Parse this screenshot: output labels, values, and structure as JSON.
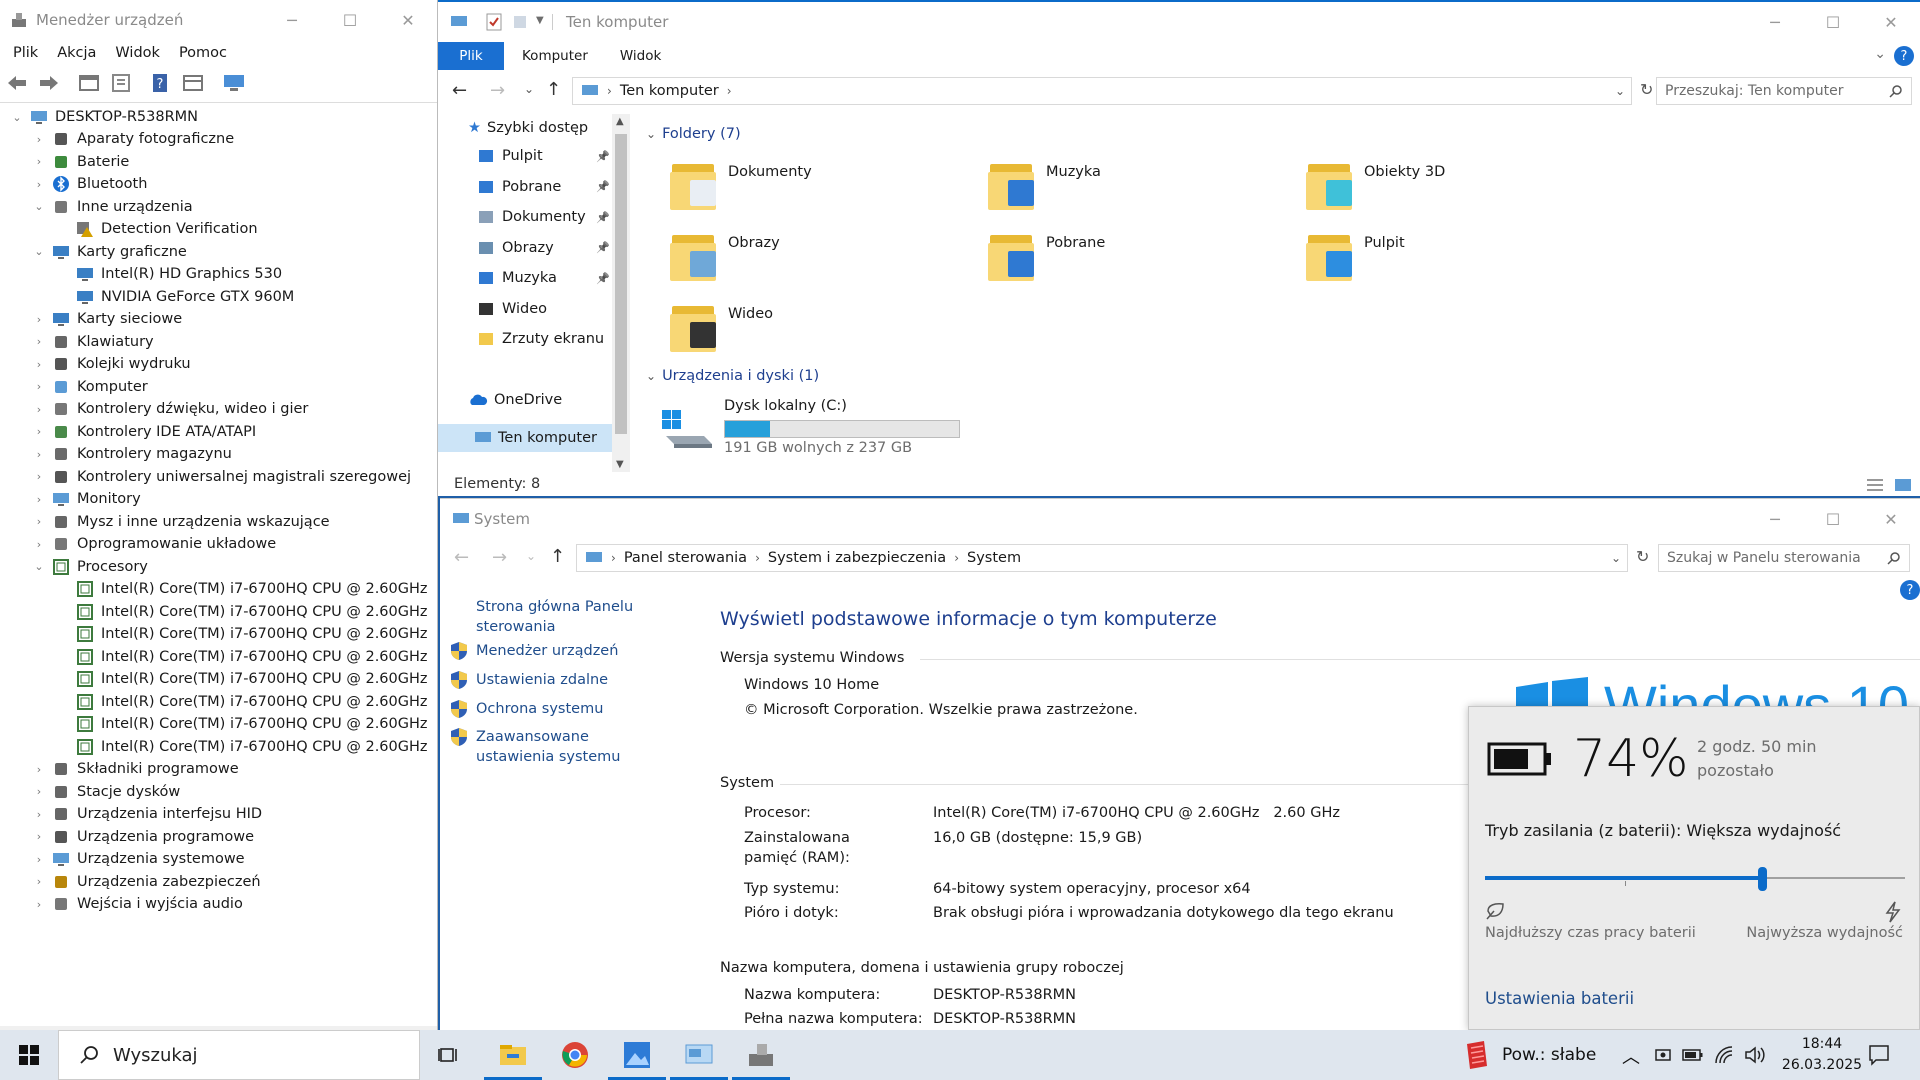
{
  "device_manager": {
    "title": "Menedżer urządzeń",
    "menu": [
      "Plik",
      "Akcja",
      "Widok",
      "Pomoc"
    ],
    "root": "DESKTOP-R538RMN",
    "nodes": [
      {
        "label": "Aparaty fotograficzne",
        "level": 1,
        "state": "collapsed",
        "icon": "camera-icon"
      },
      {
        "label": "Baterie",
        "level": 1,
        "state": "collapsed",
        "icon": "battery-icon"
      },
      {
        "label": "Bluetooth",
        "level": 1,
        "state": "collapsed",
        "icon": "bluetooth-icon"
      },
      {
        "label": "Inne urządzenia",
        "level": 1,
        "state": "expanded",
        "icon": "unknown-device-icon"
      },
      {
        "label": "Detection Verification",
        "level": 2,
        "state": "leaf",
        "icon": "warning-device-icon"
      },
      {
        "label": "Karty graficzne",
        "level": 1,
        "state": "expanded",
        "icon": "display-adapter-icon"
      },
      {
        "label": "Intel(R) HD Graphics 530",
        "level": 2,
        "state": "leaf",
        "icon": "display-adapter-icon"
      },
      {
        "label": "NVIDIA GeForce GTX 960M",
        "level": 2,
        "state": "leaf",
        "icon": "display-adapter-icon"
      },
      {
        "label": "Karty sieciowe",
        "level": 1,
        "state": "collapsed",
        "icon": "network-adapter-icon"
      },
      {
        "label": "Klawiatury",
        "level": 1,
        "state": "collapsed",
        "icon": "keyboard-icon"
      },
      {
        "label": "Kolejki wydruku",
        "level": 1,
        "state": "collapsed",
        "icon": "printer-icon"
      },
      {
        "label": "Komputer",
        "level": 1,
        "state": "collapsed",
        "icon": "computer-icon"
      },
      {
        "label": "Kontrolery dźwięku, wideo i gier",
        "level": 1,
        "state": "collapsed",
        "icon": "speaker-icon"
      },
      {
        "label": "Kontrolery IDE ATA/ATAPI",
        "level": 1,
        "state": "collapsed",
        "icon": "ide-controller-icon"
      },
      {
        "label": "Kontrolery magazynu",
        "level": 1,
        "state": "collapsed",
        "icon": "storage-controller-icon"
      },
      {
        "label": "Kontrolery uniwersalnej magistrali szeregowej",
        "level": 1,
        "state": "collapsed",
        "icon": "usb-icon"
      },
      {
        "label": "Monitory",
        "level": 1,
        "state": "collapsed",
        "icon": "monitor-icon"
      },
      {
        "label": "Mysz i inne urządzenia wskazujące",
        "level": 1,
        "state": "collapsed",
        "icon": "mouse-icon"
      },
      {
        "label": "Oprogramowanie układowe",
        "level": 1,
        "state": "collapsed",
        "icon": "firmware-icon"
      },
      {
        "label": "Procesory",
        "level": 1,
        "state": "expanded",
        "icon": "processor-icon"
      },
      {
        "label": "Intel(R) Core(TM) i7-6700HQ CPU @ 2.60GHz",
        "level": 2,
        "state": "leaf",
        "icon": "processor-icon"
      },
      {
        "label": "Intel(R) Core(TM) i7-6700HQ CPU @ 2.60GHz",
        "level": 2,
        "state": "leaf",
        "icon": "processor-icon"
      },
      {
        "label": "Intel(R) Core(TM) i7-6700HQ CPU @ 2.60GHz",
        "level": 2,
        "state": "leaf",
        "icon": "processor-icon"
      },
      {
        "label": "Intel(R) Core(TM) i7-6700HQ CPU @ 2.60GHz",
        "level": 2,
        "state": "leaf",
        "icon": "processor-icon"
      },
      {
        "label": "Intel(R) Core(TM) i7-6700HQ CPU @ 2.60GHz",
        "level": 2,
        "state": "leaf",
        "icon": "processor-icon"
      },
      {
        "label": "Intel(R) Core(TM) i7-6700HQ CPU @ 2.60GHz",
        "level": 2,
        "state": "leaf",
        "icon": "processor-icon"
      },
      {
        "label": "Intel(R) Core(TM) i7-6700HQ CPU @ 2.60GHz",
        "level": 2,
        "state": "leaf",
        "icon": "processor-icon"
      },
      {
        "label": "Intel(R) Core(TM) i7-6700HQ CPU @ 2.60GHz",
        "level": 2,
        "state": "leaf",
        "icon": "processor-icon"
      },
      {
        "label": "Składniki programowe",
        "level": 1,
        "state": "collapsed",
        "icon": "software-component-icon"
      },
      {
        "label": "Stacje dysków",
        "level": 1,
        "state": "collapsed",
        "icon": "disk-drive-icon"
      },
      {
        "label": "Urządzenia interfejsu HID",
        "level": 1,
        "state": "collapsed",
        "icon": "hid-icon"
      },
      {
        "label": "Urządzenia programowe",
        "level": 1,
        "state": "collapsed",
        "icon": "software-device-icon"
      },
      {
        "label": "Urządzenia systemowe",
        "level": 1,
        "state": "collapsed",
        "icon": "system-device-icon"
      },
      {
        "label": "Urządzenia zabezpieczeń",
        "level": 1,
        "state": "collapsed",
        "icon": "security-device-icon"
      },
      {
        "label": "Wejścia i wyjścia audio",
        "level": 1,
        "state": "collapsed",
        "icon": "audio-io-icon"
      }
    ]
  },
  "explorer": {
    "title": "Ten komputer",
    "ribbon_tabs": [
      "Plik",
      "Komputer",
      "Widok"
    ],
    "address": "Ten komputer",
    "search_placeholder": "Przeszukaj: Ten komputer",
    "sidebar": {
      "quick_access": "Szybki dostęp",
      "pinned": [
        "Pulpit",
        "Pobrane",
        "Dokumenty",
        "Obrazy",
        "Muzyka",
        "Wideo",
        "Zrzuty ekranu"
      ],
      "onedrive": "OneDrive",
      "this_pc": "Ten komputer"
    },
    "folders_header": "Foldery (7)",
    "folders": [
      "Dokumenty",
      "Muzyka",
      "Obiekty 3D",
      "Obrazy",
      "Pobrane",
      "Pulpit",
      "Wideo"
    ],
    "devices_header": "Urządzenia i dyski (1)",
    "drive": {
      "name": "Dysk lokalny (C:)",
      "free_text": "191 GB wolnych z 237 GB",
      "used_fraction": 0.194
    },
    "status": "Elementy: 8"
  },
  "system": {
    "title": "System",
    "breadcrumb": [
      "Panel sterowania",
      "System i zabezpieczenia",
      "System"
    ],
    "search_placeholder": "Szukaj w Panelu sterowania",
    "left_links": {
      "home": "Strona główna Panelu sterowania",
      "items": [
        "Menedżer urządzeń",
        "Ustawienia zdalne",
        "Ochrona systemu",
        "Zaawansowane ustawienia systemu"
      ]
    },
    "heading": "Wyświetl podstawowe informacje o tym komputerze",
    "edition_header": "Wersja systemu Windows",
    "edition": "Windows 10 Home",
    "copyright": "© Microsoft Corporation. Wszelkie prawa zastrzeżone.",
    "logo_text": "Windows 10",
    "system_header": "System",
    "rows": [
      {
        "label": "Procesor:",
        "value": "Intel(R) Core(TM) i7-6700HQ CPU @ 2.60GHz   2.60 GHz"
      },
      {
        "label": "Zainstalowana pamięć (RAM):",
        "value": "16,0 GB (dostępne: 15,9 GB)"
      },
      {
        "label": "Typ systemu:",
        "value": "64-bitowy system operacyjny, procesor x64"
      },
      {
        "label": "Pióro i dotyk:",
        "value": "Brak obsługi pióra i wprowadzania dotykowego dla tego ekranu"
      }
    ],
    "name_header": "Nazwa komputera, domena i ustawienia grupy roboczej",
    "name_rows": [
      {
        "label": "Nazwa komputera:",
        "value": "DESKTOP-R538RMN"
      },
      {
        "label": "Pełna nazwa komputera:",
        "value": "DESKTOP-R538RMN"
      }
    ]
  },
  "battery_flyout": {
    "percent": "74%",
    "remaining": "2 godz. 50 min pozostało",
    "mode": "Tryb zasilania (z baterii): Większa wydajność",
    "slider_value": 0.66,
    "left_label": "Najdłuższy czas pracy baterii",
    "right_label": "Najwyższa wydajność",
    "settings_link": "Ustawienia baterii"
  },
  "taskbar": {
    "search_placeholder": "Wyszukaj",
    "power_saver_label": "Pow.: słabe",
    "time": "18:44",
    "date": "26.03.2025"
  },
  "colors": {
    "accent": "#0b6bc9",
    "link": "#1f4d8c",
    "heading": "#1e3f8f"
  }
}
